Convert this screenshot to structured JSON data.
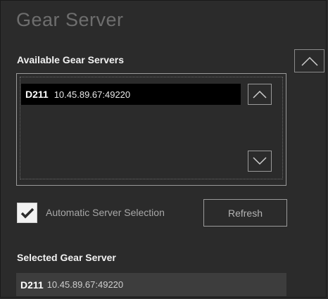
{
  "panel": {
    "title": "Gear Server"
  },
  "available": {
    "label": "Available Gear Servers",
    "items": [
      {
        "name": "D211",
        "address": "10.45.89.67:49220",
        "selected": true
      }
    ],
    "scroll_up_icon": "chevron-up-icon",
    "scroll_down_icon": "chevron-down-icon"
  },
  "collapse_icon": "chevron-up-icon",
  "auto_selection": {
    "label": "Automatic Server Selection",
    "checked": true
  },
  "refresh_button": {
    "label": "Refresh"
  },
  "selected": {
    "label": "Selected Gear Server",
    "name": "D211",
    "address": "10.45.89.67:49220"
  },
  "colors": {
    "background": "#2b2b2b",
    "item_highlight": "#000000",
    "selected_field": "#3d3d3d",
    "checkbox": "#f2f2f2"
  }
}
